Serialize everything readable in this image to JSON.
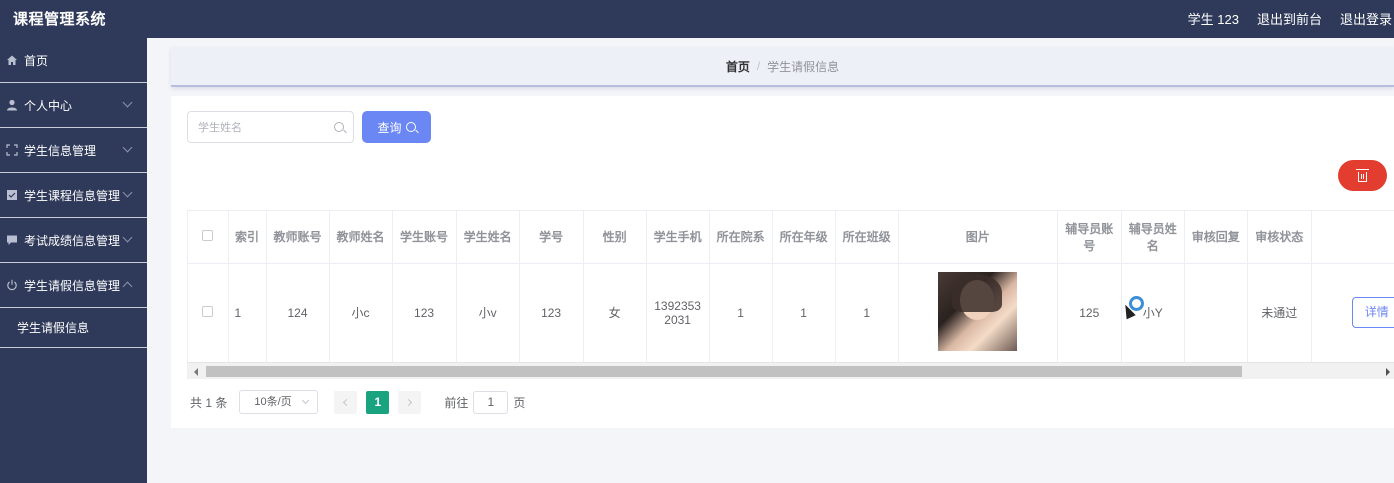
{
  "header": {
    "app_title": "课程管理系统",
    "user": "学生 123",
    "exit_front": "退出到前台",
    "logout": "退出登录"
  },
  "sidebar": {
    "items": [
      {
        "label": "首页",
        "icon": "home-icon"
      },
      {
        "label": "个人中心",
        "icon": "user-icon"
      },
      {
        "label": "学生信息管理",
        "icon": "expand-icon"
      },
      {
        "label": "学生课程信息管理",
        "icon": "checkbox-icon"
      },
      {
        "label": "考试成绩信息管理",
        "icon": "comment-icon"
      },
      {
        "label": "学生请假信息管理",
        "icon": "power-icon"
      }
    ],
    "sub_item": "学生请假信息"
  },
  "breadcrumb": {
    "home": "首页",
    "separator": "/",
    "current": "学生请假信息"
  },
  "search": {
    "placeholder": "学生姓名",
    "button_label": "查询"
  },
  "table": {
    "headers": [
      "索引",
      "教师账号",
      "教师姓名",
      "学生账号",
      "学生姓名",
      "学号",
      "性别",
      "学生手机",
      "所在院系",
      "所在年级",
      "所在班级",
      "图片",
      "辅导员账号",
      "辅导员姓名",
      "审核回复",
      "审核状态"
    ],
    "rows": [
      {
        "index": "1",
        "teacher_account": "124",
        "teacher_name": "小c",
        "student_account": "123",
        "student_name": "小v",
        "student_no": "123",
        "gender": "女",
        "phone": "13923532031",
        "department": "1",
        "grade": "1",
        "class": "1",
        "counselor_account": "125",
        "counselor_name": "小Y",
        "review_reply": "",
        "review_status": "未通过",
        "detail_label": "详情"
      }
    ]
  },
  "pagination": {
    "total": "共 1 条",
    "page_size": "10条/页",
    "current_page": "1",
    "goto_prefix": "前往",
    "goto_value": "1",
    "goto_suffix": "页"
  },
  "colors": {
    "header_bg": "#2f3a5a",
    "primary": "#6b87f3",
    "danger": "#e23d2f",
    "page_active": "#19a37e"
  }
}
